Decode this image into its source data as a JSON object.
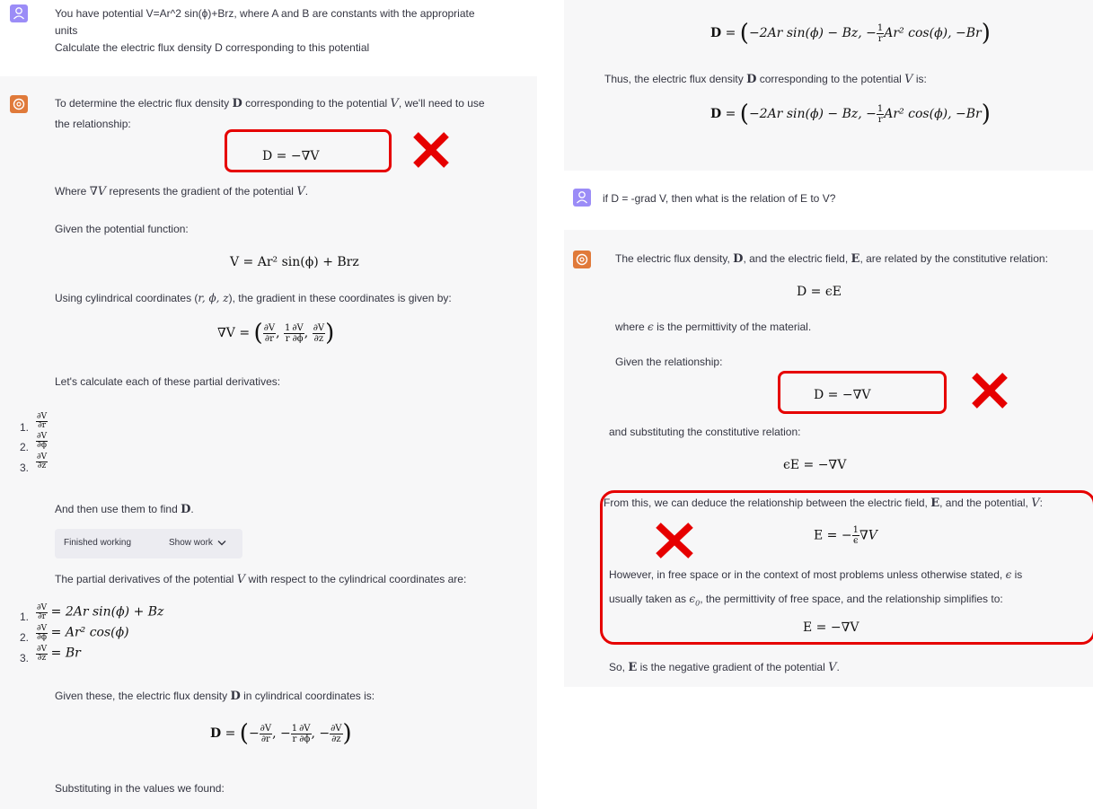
{
  "left": {
    "user_prompt": {
      "line1": "You have potential V=Ar^2  sin(ϕ)+Brz, where A and B are constants with the appropriate",
      "line2": "units",
      "line3": "Calculate the electric flux density D corresponding to this potential"
    },
    "answer": {
      "intro_a": "To determine the electric flux density",
      "intro_b": "corresponding to the potential",
      "intro_c": ", we'll need to use",
      "intro_line2": "the relationship:",
      "eq1": "D = −∇V",
      "where_a": "Where",
      "where_b": "represents the gradient of the potential",
      "given": "Given the potential function:",
      "eq2": "V = Ar² sin(ϕ) + Brz",
      "cyl_a": "Using cylindrical coordinates (",
      "cyl_vars": "r, ϕ, z",
      "cyl_b": "), the gradient in these coordinates is given by:",
      "eq3_lhs": "∇V =",
      "lets_calc": "Let's calculate each of these partial derivatives:",
      "list1": [
        "1.",
        "2.",
        "3."
      ],
      "then_use": "And then use them to find",
      "work_status": "Finished working",
      "work_toggle": "Show work",
      "partials_intro": "The partial derivatives of the potential",
      "partials_intro_b": "with respect to the cylindrical coordinates are:",
      "res1": "= 2Ar sin(ϕ) + Bz",
      "res2": "= Ar² cos(ϕ)",
      "res3": "= Br",
      "given_these": "Given these, the electric flux density",
      "given_these_b": "in cylindrical coordinates is:",
      "substituting": "Substituting in the values we found:"
    }
  },
  "right": {
    "eq_top": "−2Ar sin(ϕ) − Bz, −",
    "eq_top_b": "Ar² cos(ϕ), −Br",
    "thus": "Thus, the electric flux density",
    "thus_b": "corresponding to the potential",
    "thus_c": "is:",
    "user_q": "if D = -grad V, then what is the relation of E to V?",
    "a_line1": "The electric flux density,",
    "a_line1_b": ", and the electric field,",
    "a_line1_c": ", are related by the constitutive relation:",
    "eq_const": "D = ϵE",
    "where_eps": "where",
    "where_eps_b": "is the permittivity of the material.",
    "given_rel": "Given the relationship:",
    "eq_grad": "D = −∇V",
    "subst": "and substituting the constitutive relation:",
    "eq_eps": "ϵE = −∇V",
    "deduce": "From this, we can deduce the relationship between the electric field,",
    "deduce_b": ", and the potential,",
    "eq_e": "E = −",
    "eq_e_b": "∇V",
    "however": "However, in free space or in the context of most problems unless otherwise stated,",
    "however_b": "is",
    "usually": "usually taken as",
    "usually_b": ", the permittivity of free space, and the relationship simplifies to:",
    "eq_final": "E = −∇V",
    "so": "So,",
    "so_b": "is the negative gradient of the potential"
  },
  "colors": {
    "user_avatar": "#9b8cf7",
    "bot_avatar": "#e07a3a",
    "annotation_red": "#e60000",
    "bot_bg": "#f7f7f8"
  },
  "icons": {
    "user": "user-icon",
    "bot": "openai-logo-icon",
    "chevron": "chevron-down-icon",
    "mark": "red-x-mark"
  }
}
